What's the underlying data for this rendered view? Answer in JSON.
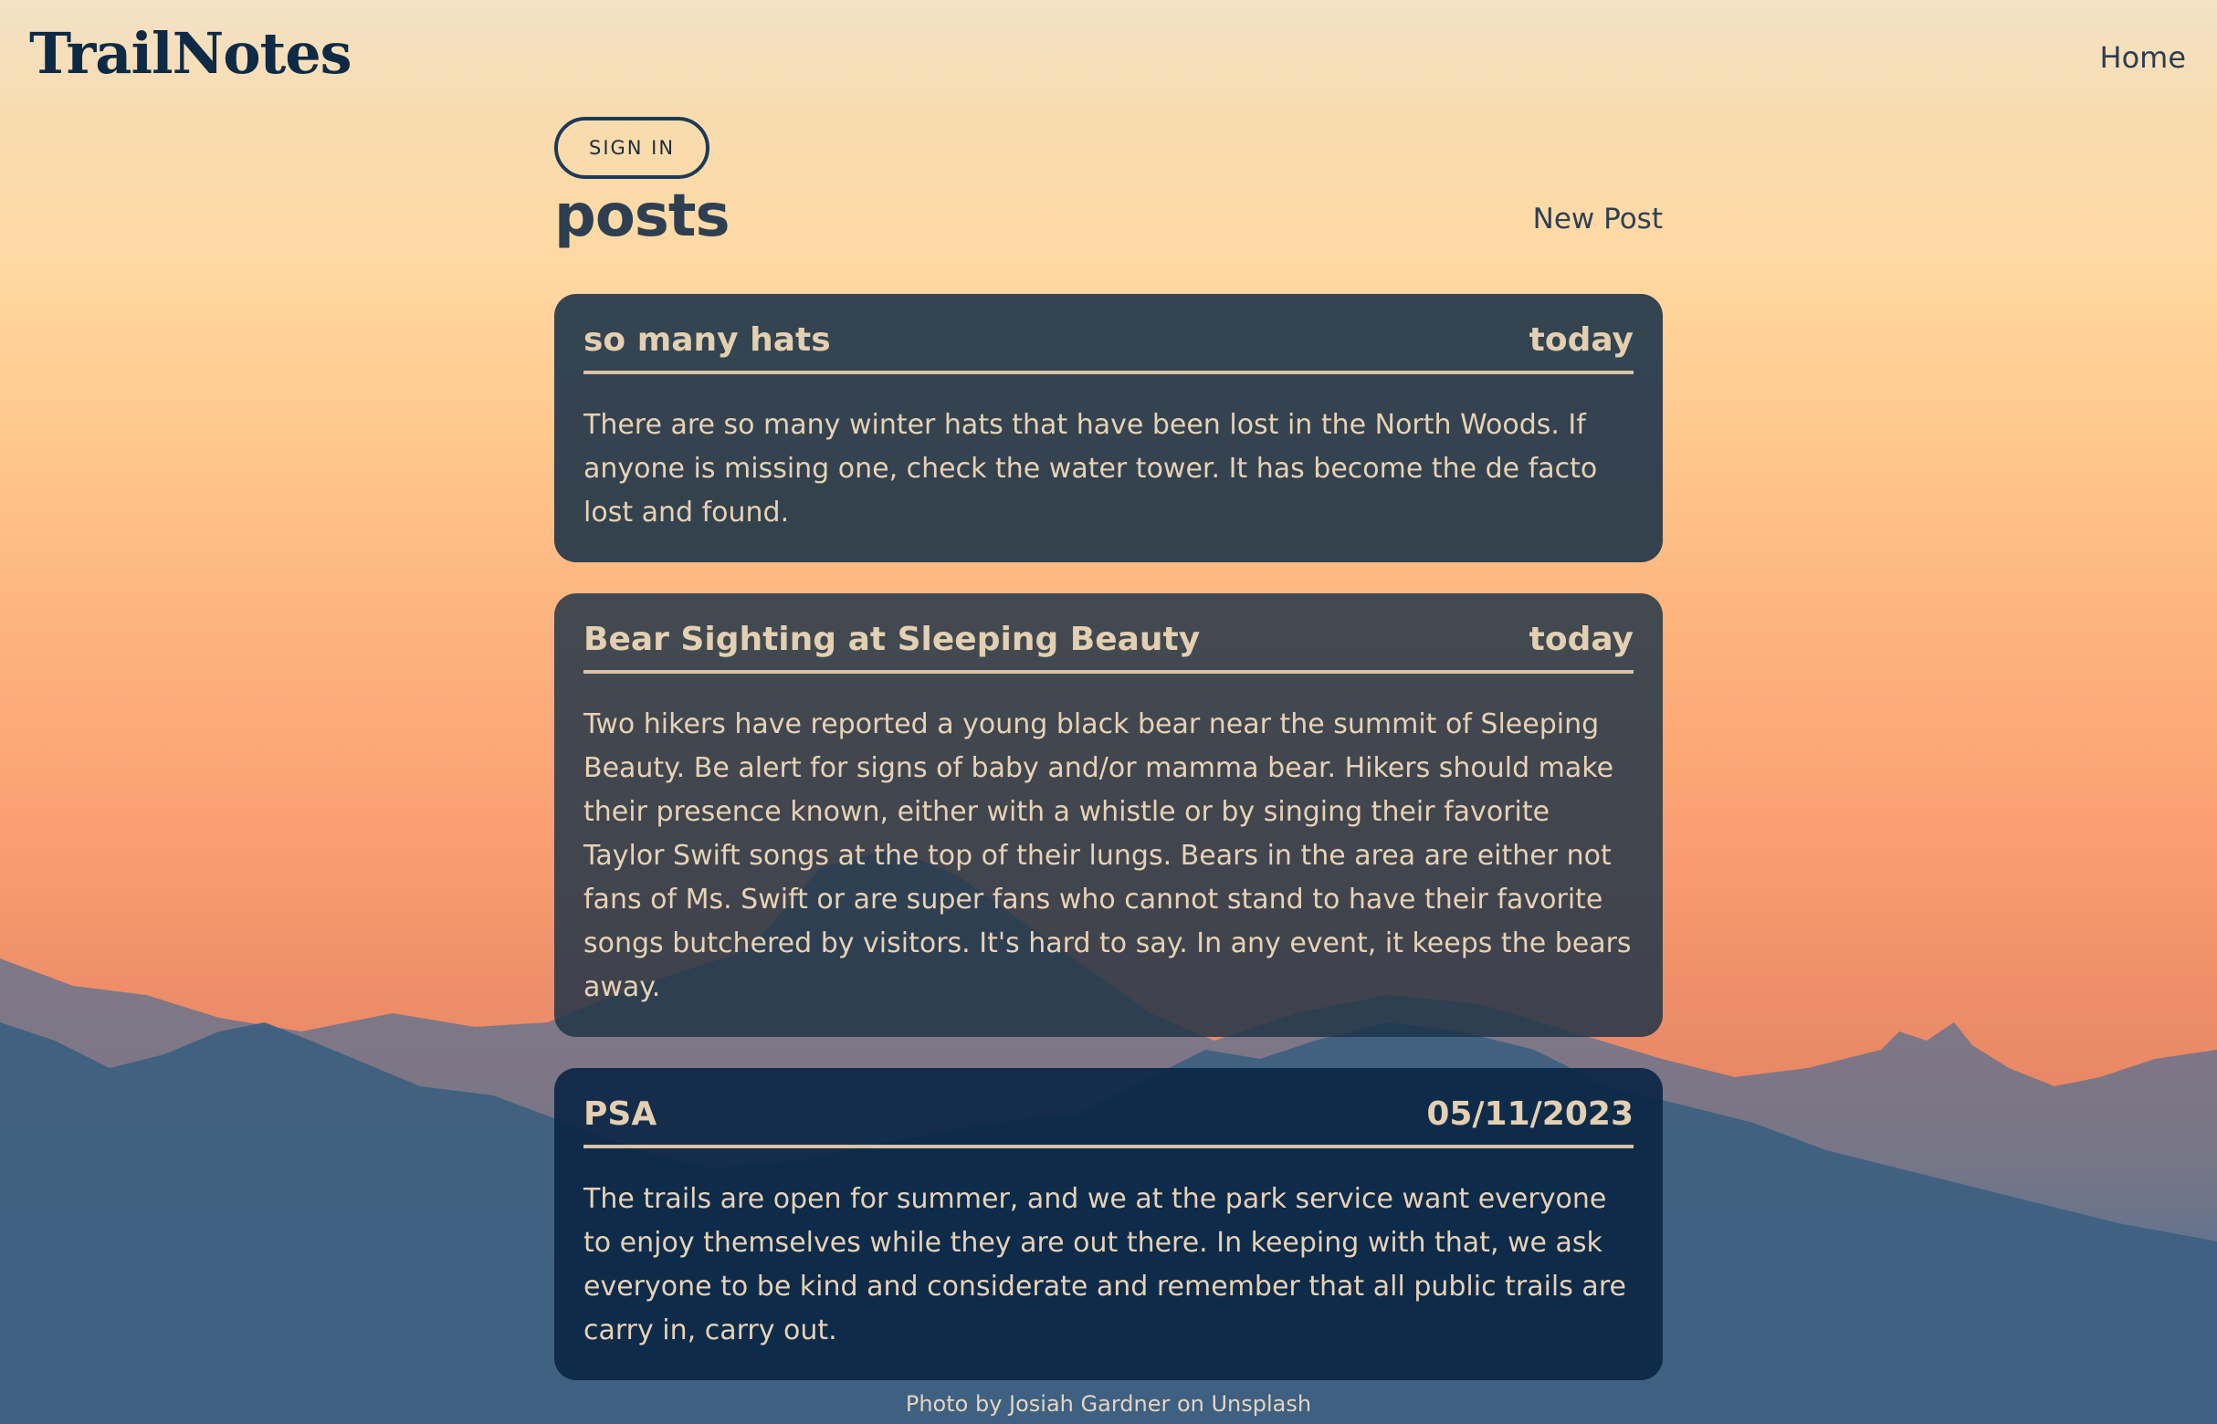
{
  "brand": {
    "name": "TrailNotes"
  },
  "nav": {
    "home": "Home"
  },
  "auth": {
    "sign_in": "SIGN IN"
  },
  "page": {
    "title": "posts",
    "new_post": "New Post"
  },
  "posts": [
    {
      "title": "so many hats",
      "date": "today",
      "body": "There are so many winter hats that have been lost in the North Woods. If anyone is missing one, check the water tower. It has become the de facto lost and found."
    },
    {
      "title": "Bear Sighting at Sleeping Beauty",
      "date": "today",
      "body": "Two hikers have reported a young black bear near the summit of Sleeping Beauty. Be alert for signs of baby and/or mamma bear. Hikers should make their presence known, either with a whistle or by singing their favorite Taylor Swift songs at the top of their lungs. Bears in the area are either not fans of Ms. Swift or are super fans who cannot stand to have their favorite songs butchered by visitors. It's hard to say. In any event, it keeps the bears away."
    },
    {
      "title": "PSA",
      "date": "05/11/2023",
      "body": "The trails are open for summer, and we at the park service want everyone to enjoy themselves while they are out there. In keeping with that, we ask everyone to be kind and considerate and remember that all public trails are carry in, carry out."
    }
  ],
  "footer": {
    "credit": "Photo by Josiah Gardner on Unsplash"
  },
  "colors": {
    "brand": "#0f2a44",
    "card": "#1e3448",
    "card_text": "#e6d2b5",
    "button_border": "#1c3a58"
  }
}
